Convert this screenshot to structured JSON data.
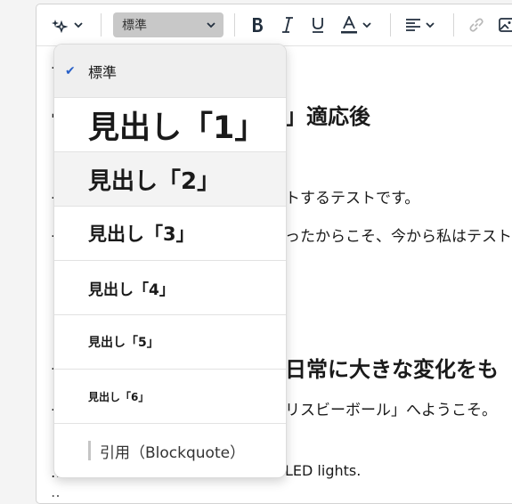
{
  "toolbar": {
    "style_select_value": "標準",
    "icons": [
      "ai-sparkle-icon",
      "chevron-down-icon",
      "bold-icon",
      "italic-icon",
      "underline-icon",
      "text-color-icon",
      "align-icon",
      "link-icon",
      "image-icon"
    ]
  },
  "content_lines": {
    "line1": "」適応後",
    "line2": "トするテストです。",
    "line3": "ったからこそ、今から私はテスト",
    "line4": "日常に大きな変化をも",
    "line5": "リスビーボール」へようこそ。",
    "line6": "LED lights."
  },
  "menu": {
    "items": [
      {
        "label": "標準"
      },
      {
        "label": "見出し「1」"
      },
      {
        "label": "見出し「2」"
      },
      {
        "label": "見出し「3」"
      },
      {
        "label": "見出し「4」"
      },
      {
        "label": "見出し「5」"
      },
      {
        "label": "見出し「6」"
      },
      {
        "label": "引用（Blockquote）"
      }
    ]
  },
  "colors": {
    "accent": "#2860c8",
    "select_bg": "#c8c8c8"
  }
}
